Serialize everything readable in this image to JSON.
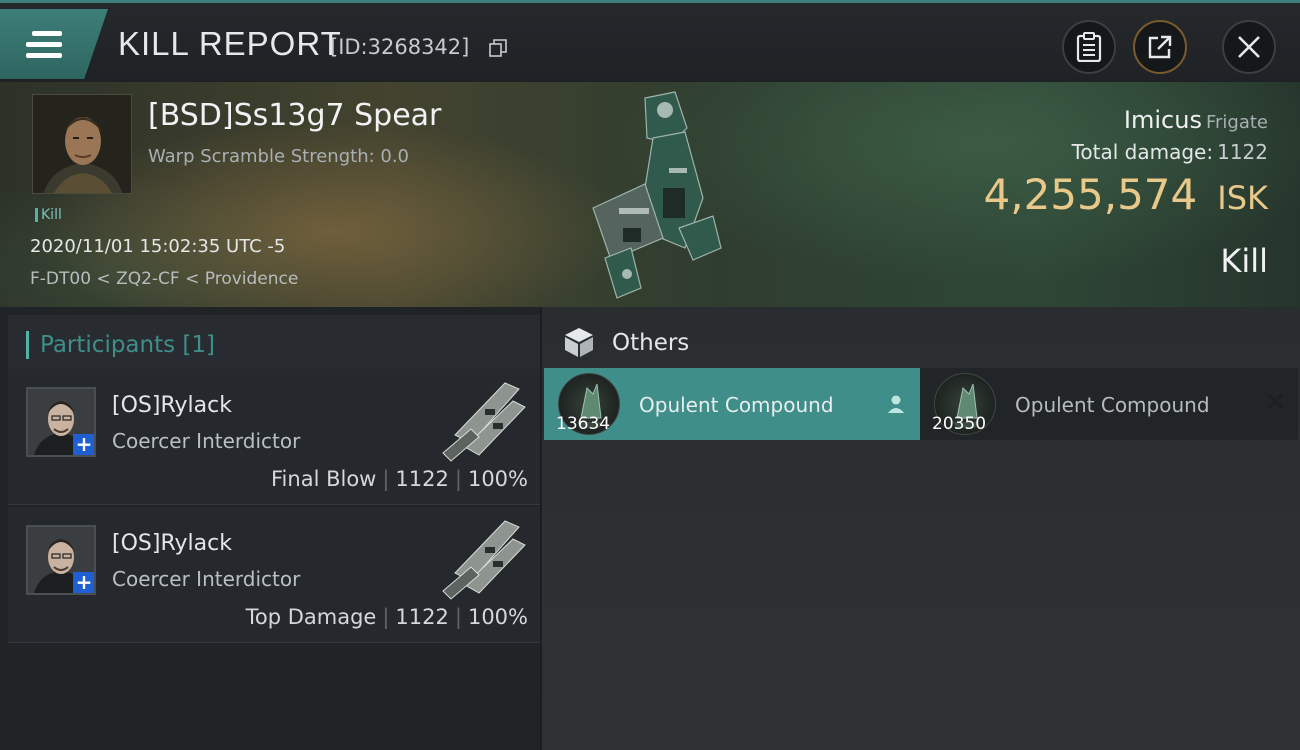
{
  "header": {
    "title": "KILL REPORT",
    "report_id": "[ID:3268342]"
  },
  "victim": {
    "name": "[BSD]Ss13g7 Spear",
    "warp_scramble": "Warp Scramble Strength: 0.0",
    "tag": "Kill",
    "datetime": "2020/11/01 15:02:35 UTC -5",
    "location": "F-DT00 < ZQ2-CF < Providence",
    "ship_name": "Imicus",
    "ship_class": "Frigate",
    "total_damage_label": "Total damage:",
    "total_damage": "1122",
    "isk_value": "4,255,574",
    "isk_unit": "ISK",
    "result": "Kill"
  },
  "participants": {
    "header": "Participants [1]",
    "rows": [
      {
        "name": "[OS]Rylack",
        "ship": "Coercer Interdictor",
        "role": "Final Blow",
        "damage": "1122",
        "percent": "100%"
      },
      {
        "name": "[OS]Rylack",
        "ship": "Coercer Interdictor",
        "role": "Top Damage",
        "damage": "1122",
        "percent": "100%"
      }
    ]
  },
  "others": {
    "title": "Others",
    "items": [
      {
        "name": "Opulent Compound",
        "quantity": "13634"
      },
      {
        "name": "Opulent Compound",
        "quantity": "20350"
      }
    ]
  },
  "icons": {
    "menu": "menu-icon",
    "copy": "copy-icon",
    "clipboard": "clipboard-icon",
    "share": "share-icon",
    "close": "close-icon",
    "box": "box-icon",
    "person": "person-icon",
    "remove": "remove-icon"
  },
  "colors": {
    "accent": "#3f8e8a",
    "isk": "#e8c98a",
    "share_ring": "#7b5a2c",
    "plus_badge": "#1f5fd1"
  }
}
